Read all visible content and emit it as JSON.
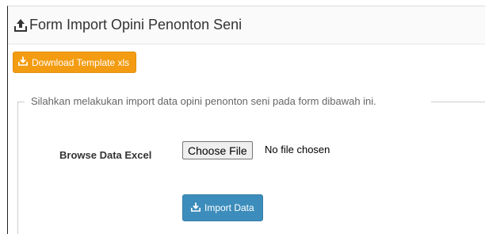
{
  "header": {
    "title": "Form Import Opini Penonton Seni",
    "icon": "upload-tray-icon"
  },
  "toolbar": {
    "download_label": "Download Template xls",
    "download_icon": "download-tray-icon",
    "download_color": "#f39c12"
  },
  "form": {
    "legend": "Silahkan melakukan import data opini penonton seni pada form dibawah ini.",
    "browse_label": "Browse Data Excel",
    "choose_file_label": "Choose File",
    "no_file_text": "No file chosen",
    "import_label": "Import Data",
    "import_icon": "download-tray-icon",
    "import_color": "#3c8dbc"
  }
}
